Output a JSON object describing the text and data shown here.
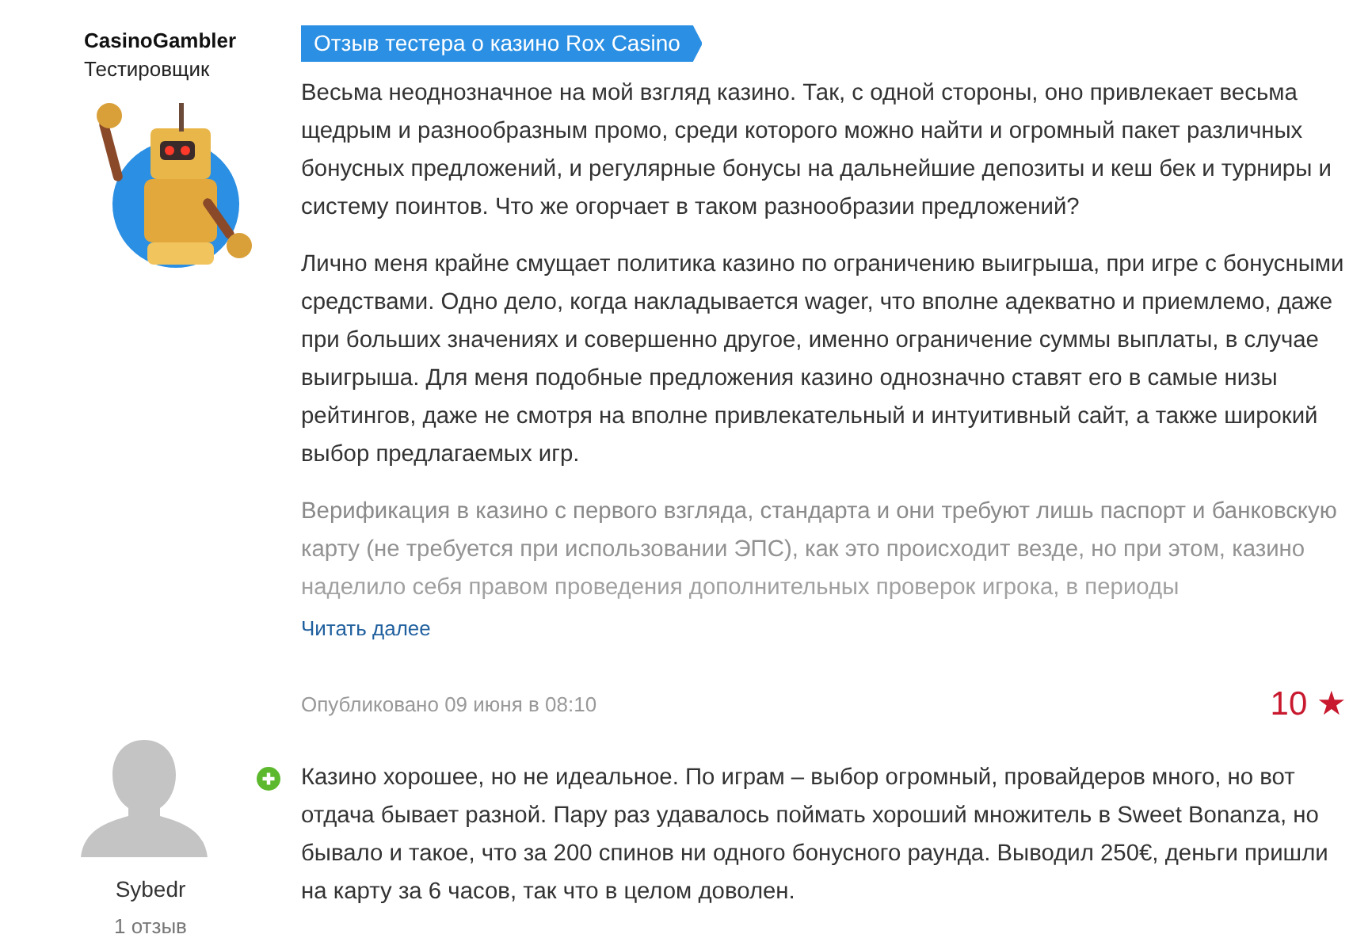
{
  "reviewer": {
    "name": "CasinoGambler",
    "role": "Тестировщик"
  },
  "review": {
    "badge": "Отзыв тестера о казино Rox Casino",
    "paragraphs": [
      {
        "text": "Весьма неоднозначное на мой взгляд казино. Так, с одной стороны, оно привлекает весьма щедрым и разнообразным промо, среди которого можно найти и огромный пакет различных бонусных предложений, и регулярные бонусы на дальнейшие депозиты и кеш бек и турниры и систему поинтов. Что же огорчает в таком разнообразии предложений?",
        "faded": false
      },
      {
        "text": "Лично меня крайне смущает политика казино по ограничению выигрыша, при игре с бонусными средствами. Одно дело, когда накладывается wager, что вполне адекватно и приемлемо, даже при больших значениях и совершенно другое, именно ограничение суммы выплаты, в случае выигрыша. Для меня подобные предложения казино однозначно ставят его в самые низы рейтингов, даже не смотря на вполне привлекательный и интуитивный сайт, а также широкий выбор предлагаемых игр.",
        "faded": false
      },
      {
        "text": "Верификация в казино с первого взгляда, стандарта и они требуют лишь паспорт и банковскую карту (не требуется при использовании ЭПС), как это происходит везде, но при этом, казино наделило себя правом проведения дополнительных проверок игрока, в периоды",
        "faded": true
      }
    ],
    "read_more": "Читать далее"
  },
  "published": "Опубликовано 09 июня в 08:10",
  "rating": {
    "value": "10",
    "star": "★"
  },
  "comments": [
    {
      "author": "Sybedr",
      "count": "1 отзыв",
      "kind": "positive",
      "text": "Казино хорошее, но не идеальное. По играм – выбор огромный, провайдеров много, но вот отдача бывает разной. Пару раз удавалось поймать хороший множитель в Sweet Bonanza, но бывало и такое, что за 200 спинов ни одного бонусного раунда. Выводил 250€, деньги пришли на карту за 6 часов, так что в целом доволен."
    }
  ]
}
